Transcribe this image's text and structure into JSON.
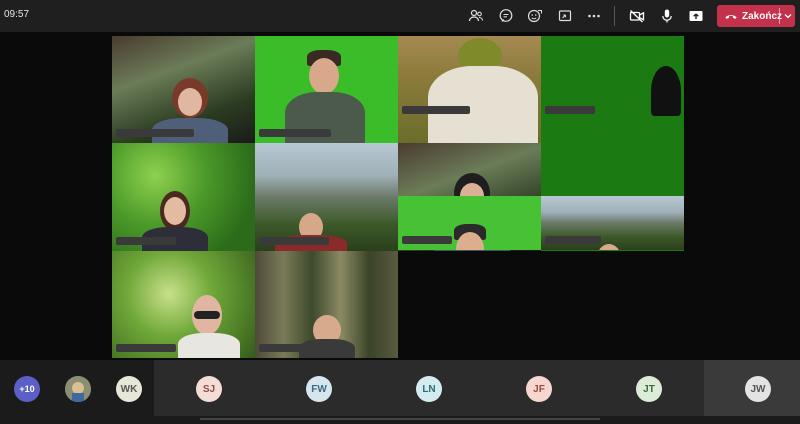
{
  "header": {
    "time": "09:57",
    "end_call_label": "Zakończ",
    "accent": "#c4314b"
  },
  "toolbar_icons": [
    "people-icon",
    "chat-icon",
    "reactions-icon",
    "share-tray-icon",
    "more-options-icon",
    "camera-off-icon",
    "microphone-icon",
    "share-screen-icon"
  ],
  "participants_bar": {
    "overflow_label": "+10",
    "items": [
      {
        "initials": "WK",
        "bg": "#e7e7d8",
        "fg": "#555"
      },
      {
        "initials": "SJ",
        "bg": "#f3ddd5",
        "fg": "#8a4f3e"
      },
      {
        "initials": "FW",
        "bg": "#d6e6ee",
        "fg": "#3e6a80"
      },
      {
        "initials": "LN",
        "bg": "#d4ecf0",
        "fg": "#2c6a78"
      },
      {
        "initials": "JF",
        "bg": "#f6d6cf",
        "fg": "#9a4a3a"
      },
      {
        "initials": "JT",
        "bg": "#dcecd8",
        "fg": "#3e6a3a"
      },
      {
        "initials": "JW",
        "bg": "#e3e3e3",
        "fg": "#555"
      }
    ]
  }
}
